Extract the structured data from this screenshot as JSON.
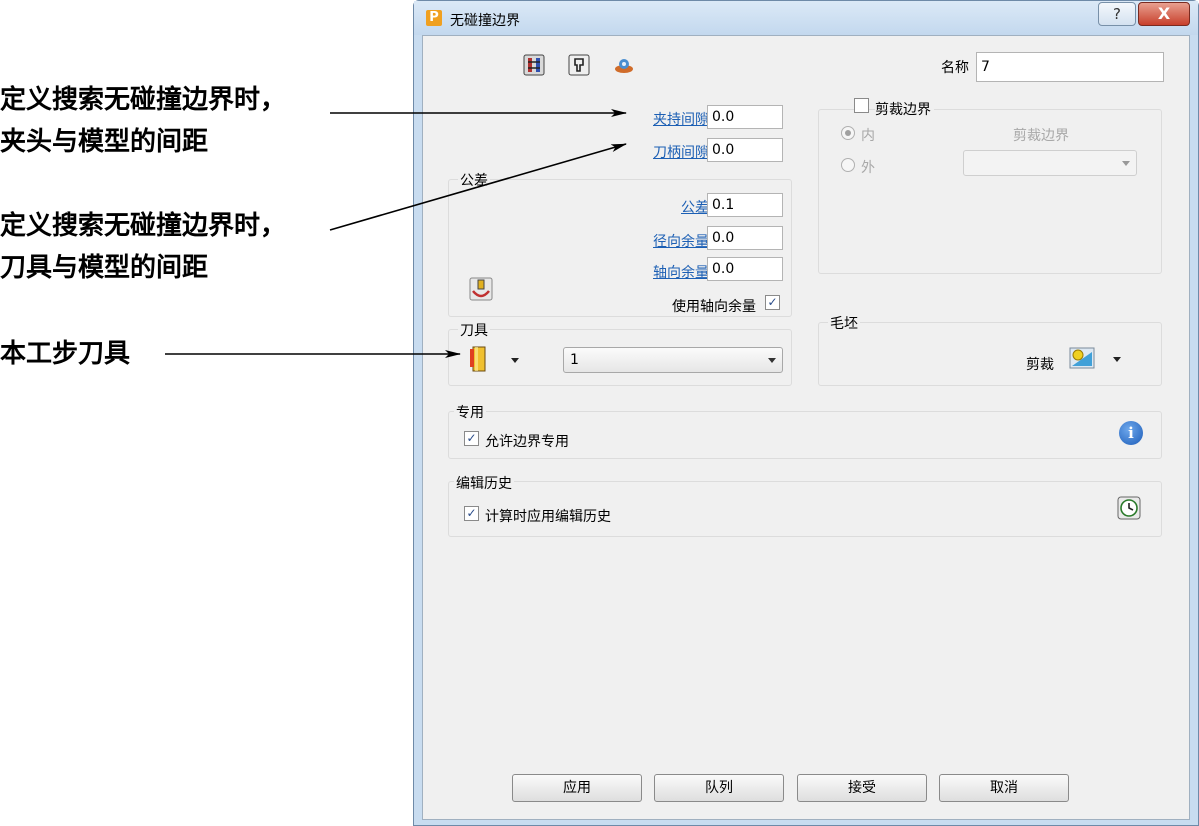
{
  "annotations": {
    "a1_line1": "定义搜索无碰撞边界时，",
    "a1_line2": "夹头与模型的间距",
    "a2_line1": "定义搜索无碰撞边界时，",
    "a2_line2": "刀具与模型的间距",
    "a3": "本工步刀具"
  },
  "window": {
    "title": "无碰撞边界",
    "app_icon_letter": "P",
    "help_symbol": "?",
    "close_symbol": "X"
  },
  "toolbar": {
    "icons": [
      "boundary-type-icon",
      "holder-icon",
      "settings-icon"
    ]
  },
  "name_field": {
    "label": "名称",
    "value": "7"
  },
  "clearance": {
    "holder_label": "夹持间隙",
    "holder_value": "0.0",
    "shank_label": "刀柄间隙",
    "shank_value": "0.0"
  },
  "tolerance_group": {
    "title": "公差",
    "tolerance_label": "公差",
    "tolerance_value": "0.1",
    "radial_label": "径向余量",
    "radial_value": "0.0",
    "axial_label": "轴向余量",
    "axial_value": "0.0",
    "use_axial_label": "使用轴向余量",
    "use_axial_checked": true
  },
  "trim_group": {
    "checkbox_label": "剪裁边界",
    "inside_label": "内",
    "outside_label": "外",
    "trim_boundary_label": "剪裁边界",
    "trim_boundary_value": ""
  },
  "tool_group": {
    "title": "刀具",
    "tool_value": "1"
  },
  "block_group": {
    "title": "毛坯",
    "trim_label": "剪裁"
  },
  "dedicated_group": {
    "title": "专用",
    "allow_label": "允许边界专用",
    "allow_checked": true
  },
  "history_group": {
    "title": "编辑历史",
    "apply_label": "计算时应用编辑历史",
    "apply_checked": true
  },
  "buttons": {
    "apply": "应用",
    "queue": "队列",
    "accept": "接受",
    "cancel": "取消"
  },
  "check_mark": "✓",
  "info_symbol": "i",
  "colors": {
    "link": "#1c5fb4",
    "window_frame": "#c8dcf0",
    "close_red": "#c8402c"
  }
}
